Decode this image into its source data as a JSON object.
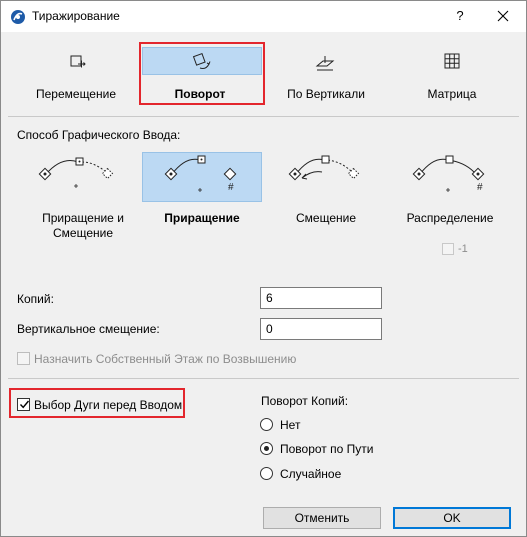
{
  "window": {
    "title": "Тиражирование",
    "help_label": "?"
  },
  "modes": [
    {
      "label": "Перемещение",
      "icon": "move-icon"
    },
    {
      "label": "Поворот",
      "icon": "rotate-icon",
      "selected": true
    },
    {
      "label": "По Вертикали",
      "icon": "vertical-icon"
    },
    {
      "label": "Матрица",
      "icon": "matrix-icon"
    }
  ],
  "input_method": {
    "heading": "Способ Графического Ввода:",
    "options": [
      {
        "label": "Приращение и Смещение",
        "icon": "increment-offset-icon"
      },
      {
        "label": "Приращение",
        "icon": "increment-icon",
        "selected": true
      },
      {
        "label": "Смещение",
        "icon": "offset-icon"
      },
      {
        "label": "Распределение",
        "icon": "distribution-icon"
      }
    ],
    "extra_check_label": "-1"
  },
  "fields": {
    "copies_label": "Копий:",
    "copies_value": "6",
    "vertical_offset_label": "Вертикальное смещение:",
    "vertical_offset_value": "0"
  },
  "options": {
    "assign_floor_label": "Назначить Собственный Этаж по Возвышению",
    "assign_floor_checked": false,
    "select_arc_label": "Выбор Дуги перед Вводом",
    "select_arc_checked": true
  },
  "rotation": {
    "heading": "Поворот Копий:",
    "choices": [
      "Нет",
      "Поворот по Пути",
      "Случайное"
    ],
    "selected": "Поворот по Пути"
  },
  "buttons": {
    "cancel_label": "Отменить",
    "ok_label": "OK"
  },
  "colors": {
    "selection": "#bcd9f3",
    "highlight_frame": "#e3262d",
    "default_button_border": "#0078d7"
  }
}
